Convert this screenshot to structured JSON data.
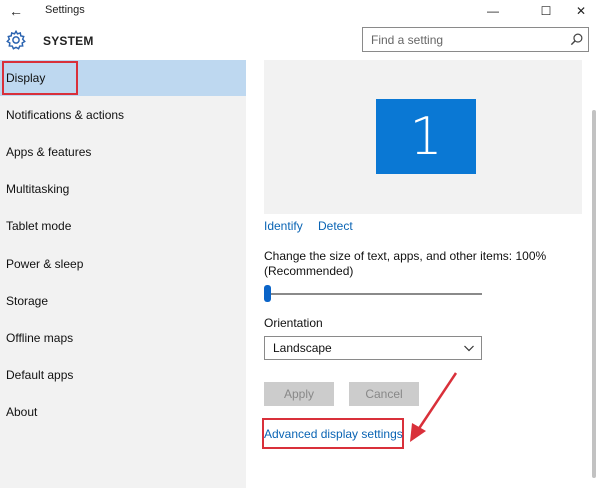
{
  "window": {
    "title": "Settings",
    "back_glyph": "←",
    "minimize_glyph": "—",
    "maximize_glyph": "☐",
    "close_glyph": "✕"
  },
  "header": {
    "icon": "gear-icon",
    "title": "SYSTEM",
    "search_placeholder": "Find a setting",
    "search_icon": "search-icon"
  },
  "sidebar": {
    "items": [
      {
        "label": "Display",
        "active": true
      },
      {
        "label": "Notifications & actions"
      },
      {
        "label": "Apps & features"
      },
      {
        "label": "Multitasking"
      },
      {
        "label": "Tablet mode"
      },
      {
        "label": "Power & sleep"
      },
      {
        "label": "Storage"
      },
      {
        "label": "Offline maps"
      },
      {
        "label": "Default apps"
      },
      {
        "label": "About"
      }
    ]
  },
  "display": {
    "monitor_number": "1",
    "identify_label": "Identify",
    "detect_label": "Detect",
    "scale_label": "Change the size of text, apps, and other items: 100% (Recommended)",
    "scale_value_percent": 100,
    "orientation_label": "Orientation",
    "orientation_value": "Landscape",
    "apply_label": "Apply",
    "cancel_label": "Cancel",
    "advanced_link": "Advanced display settings"
  },
  "colors": {
    "accent": "#0a78d4",
    "highlight": "#d9303a",
    "selected": "#bed8f0"
  }
}
